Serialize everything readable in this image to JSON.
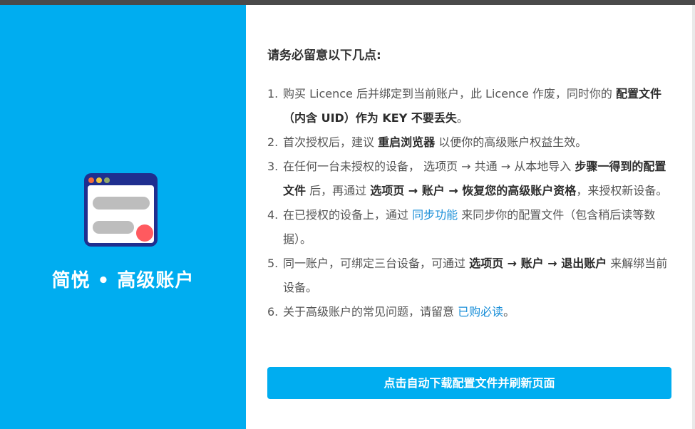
{
  "colors": {
    "brand": "#00adf0",
    "link": "#1a8fd8",
    "text": "#555555",
    "strong": "#2c2c2c"
  },
  "sidebar": {
    "logo_icon": "browser-window-icon",
    "title": "简悦 • 高级账户"
  },
  "notice": {
    "title": "请务必留意以下几点:",
    "items": [
      {
        "num": "1.",
        "t1": "购买 Licence 后并绑定到当前账户，此 Licence 作废，同时你的 ",
        "b1": "配置文件（内含 UID）作为 KEY 不要丢失",
        "t2": "。"
      },
      {
        "num": "2.",
        "t1": "首次授权后，建议 ",
        "b1": "重启浏览器",
        "t2": " 以便你的高级账户权益生效。"
      },
      {
        "num": "3.",
        "t1": "在任何一台未授权的设备， 选项页 → 共通 → 从本地导入 ",
        "b1": "步骤一得到的配置文件",
        "t2": " 后，再通过 ",
        "b2": "选项页 → 账户 → 恢复您的高级账户资格",
        "t3": "，来授权新设备。"
      },
      {
        "num": "4.",
        "t1": "在已授权的设备上，通过 ",
        "link": "同步功能",
        "t2": " 来同步你的配置文件（包含稍后读等数据）。"
      },
      {
        "num": "5.",
        "t1": "同一账户，可绑定三台设备，可通过 ",
        "b1": "选项页 → 账户 → 退出账户",
        "t2": " 来解绑当前设备。"
      },
      {
        "num": "6.",
        "t1": "关于高级账户的常见问题，请留意 ",
        "link": "已购必读",
        "t2": "。"
      }
    ]
  },
  "action": {
    "button_label": "点击自动下载配置文件并刷新页面"
  }
}
